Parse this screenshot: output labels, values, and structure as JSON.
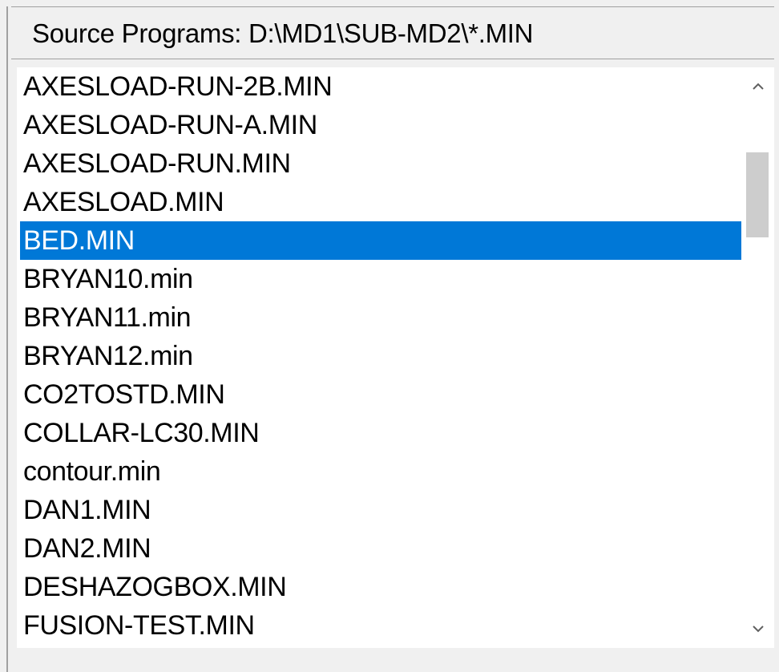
{
  "header": {
    "title": "Source Programs: D:\\MD1\\SUB-MD2\\*.MIN"
  },
  "list": {
    "selected_index": 4,
    "items": [
      "AXESLOAD-RUN-2B.MIN",
      "AXESLOAD-RUN-A.MIN",
      "AXESLOAD-RUN.MIN",
      "AXESLOAD.MIN",
      "BED.MIN",
      "BRYAN10.min",
      "BRYAN11.min",
      "BRYAN12.min",
      "CO2TOSTD.MIN",
      "COLLAR-LC30.MIN",
      "contour.min",
      "DAN1.MIN",
      "DAN2.MIN",
      "DESHAZOGBOX.MIN",
      "FUSION-TEST.MIN"
    ]
  },
  "scrollbar": {
    "up_icon": "chevron-up-icon",
    "down_icon": "chevron-down-icon"
  },
  "colors": {
    "selection": "#0078d7",
    "selection_text": "#ffffff",
    "list_background": "#ffffff",
    "window_background": "#f0f0f0",
    "scroll_thumb": "#cdcdcd"
  }
}
